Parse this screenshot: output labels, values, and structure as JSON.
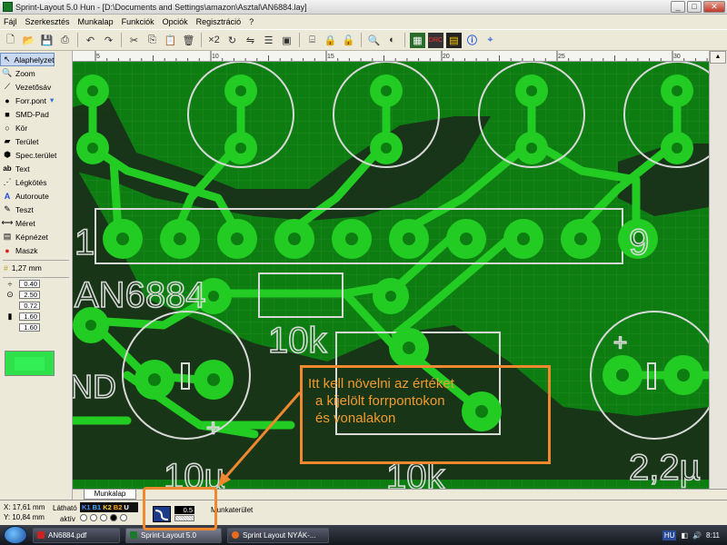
{
  "window": {
    "title": "Sprint-Layout 5.0 Hun   - [D:\\Documents and Settings\\amazon\\Asztal\\AN6884.lay]"
  },
  "menu": [
    "Fájl",
    "Szerkesztés",
    "Munkalap",
    "Funkciók",
    "Opciók",
    "Regisztráció",
    "?"
  ],
  "tools": [
    {
      "label": "Alaphelyzet",
      "icon": "arrow-icon"
    },
    {
      "label": "Zoom",
      "icon": "zoom-icon"
    },
    {
      "label": "Vezetősáv",
      "icon": "track-icon"
    },
    {
      "label": "Forr.pont",
      "icon": "pad-icon"
    },
    {
      "label": "SMD-Pad",
      "icon": "smd-icon"
    },
    {
      "label": "Kör",
      "icon": "circle-icon"
    },
    {
      "label": "Terület",
      "icon": "area-icon"
    },
    {
      "label": "Spec.terület",
      "icon": "special-area-icon"
    },
    {
      "label": "Text",
      "icon": "text-icon"
    },
    {
      "label": "Légkötés",
      "icon": "airwire-icon"
    },
    {
      "label": "Autoroute",
      "icon": "autoroute-icon"
    },
    {
      "label": "Teszt",
      "icon": "test-icon"
    },
    {
      "label": "Méret",
      "icon": "measure-icon"
    },
    {
      "label": "Képnézet",
      "icon": "photoview-icon"
    },
    {
      "label": "Maszk",
      "icon": "mask-icon"
    }
  ],
  "grid": {
    "value": "1,27 mm"
  },
  "params": [
    "0.40",
    "2.50",
    "0.72",
    "1.60",
    "1.60"
  ],
  "ruler": {
    "ticks": [
      "5",
      "10",
      "15",
      "20",
      "25",
      "30"
    ]
  },
  "silk_texts": {
    "ic_left": "1",
    "ic_right": "9",
    "chip": "AN6884",
    "res1": "10k",
    "res2": "10k",
    "gnd": "ND",
    "cap_left": "10µ",
    "cap_right": "2,2µ",
    "plus": "+"
  },
  "annotation": {
    "lines": [
      "Itt kell növelni az értéket",
      "a kijelölt forrpontokon",
      "és vonalakon"
    ]
  },
  "tab": {
    "label": "Munkalap"
  },
  "status": {
    "x": "X:  17,61 mm",
    "y": "Y:  10,84 mm",
    "lathato": "Látható",
    "aktiv": "aktív",
    "layers": [
      "K1",
      "B1",
      "K2",
      "B2",
      "U"
    ],
    "width": "0.5",
    "munkaterulet": "Munkaterület"
  },
  "taskbar": {
    "items": [
      "AN6884.pdf",
      "Sprint-Layout 5.0",
      "Sprint Layout NYÁK-..."
    ],
    "lang": "HU",
    "time": "8:11"
  },
  "colors": {
    "board": "#0d7d12",
    "copper": "#22cc22",
    "silk": "#d8d8d8",
    "annotation": "#f08830"
  }
}
